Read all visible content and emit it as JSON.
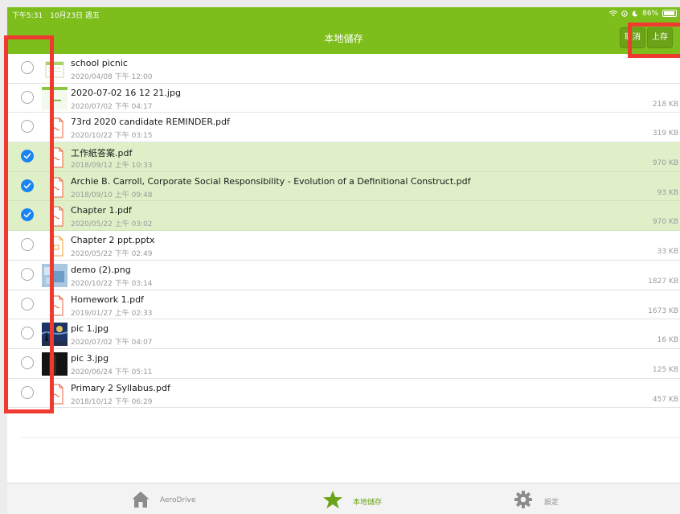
{
  "status_bar": {
    "time": "下午5:31",
    "date": "10月23日 週五",
    "battery": "86%"
  },
  "nav": {
    "title": "本地儲存",
    "cancel_label": "取消",
    "upload_label": "上存"
  },
  "files": [
    {
      "name": "school picnic",
      "date": "2020/04/08 下午 12:00",
      "size": "",
      "selected": false,
      "type": "folder"
    },
    {
      "name": "2020-07-02 16 12 21.jpg",
      "date": "2020/07/02 下午 04:17",
      "size": "218 KB",
      "selected": false,
      "type": "image-green"
    },
    {
      "name": "73rd 2020 candidate REMINDER.pdf",
      "date": "2020/10/22 下午 03:15",
      "size": "319 KB",
      "selected": false,
      "type": "pdf"
    },
    {
      "name": "工作紙答案.pdf",
      "date": "2018/09/12 上午 10:33",
      "size": "970 KB",
      "selected": true,
      "type": "pdf"
    },
    {
      "name": "Archie B. Carroll, Corporate Social Responsibility - Evolution of a Definitional Construct.pdf",
      "date": "2018/09/10 上午 09:48",
      "size": "93 KB",
      "selected": true,
      "type": "pdf"
    },
    {
      "name": "Chapter 1.pdf",
      "date": "2020/05/22 上午 03:02",
      "size": "970 KB",
      "selected": true,
      "type": "pdf"
    },
    {
      "name": "Chapter 2 ppt.pptx",
      "date": "2020/05/22 下午 02:49",
      "size": "33 KB",
      "selected": false,
      "type": "pptx"
    },
    {
      "name": "demo (2).png",
      "date": "2020/10/22 下午 03:14",
      "size": "1827 KB",
      "selected": false,
      "type": "image-blue"
    },
    {
      "name": "Homework 1.pdf",
      "date": "2019/01/27 上午 02:33",
      "size": "1673 KB",
      "selected": false,
      "type": "pdf"
    },
    {
      "name": "pic 1.jpg",
      "date": "2020/07/02 下午 04:07",
      "size": "16 KB",
      "selected": false,
      "type": "image-night"
    },
    {
      "name": "pic 3.jpg",
      "date": "2020/06/24 下午 05:11",
      "size": "125 KB",
      "selected": false,
      "type": "image-dark"
    },
    {
      "name": "Primary 2 Syllabus.pdf",
      "date": "2018/10/12 下午 06:29",
      "size": "457 KB",
      "selected": false,
      "type": "pdf"
    }
  ],
  "tabs": [
    {
      "label": "AeroDrive",
      "icon": "house-icon",
      "active": false
    },
    {
      "label": "本地儲存",
      "icon": "star-icon",
      "active": true
    },
    {
      "label": "設定",
      "icon": "gear-icon",
      "active": false
    }
  ],
  "colors": {
    "accent": "#7dbd1c",
    "selected_row": "#dff0c8",
    "checkbox": "#1a84f5",
    "annotation": "#ef3a2f"
  }
}
